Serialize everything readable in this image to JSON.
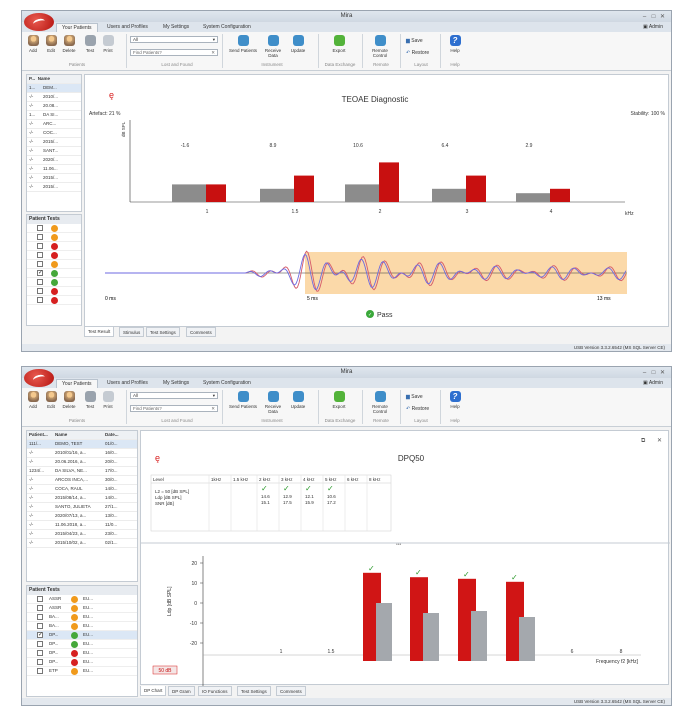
{
  "window_title": "Mira",
  "ribbon_tabs": [
    "Your Patients",
    "Users and Profiles",
    "My Settings",
    "System Configuration"
  ],
  "user_label": "Admin",
  "ribbon": {
    "buttons": [
      "Add",
      "Edit",
      "Delete",
      "Test",
      "Print"
    ],
    "filter_value": "All",
    "find_placeholder": "Find Patients?",
    "instrument_buttons": [
      "Send Patients",
      "Receive Data",
      "Update"
    ],
    "export_label": "Export",
    "remote_label": "Remote Control",
    "save_label": "Save",
    "restore_label": "Restore",
    "help_label": "Help",
    "groups": [
      "Patients",
      "Lost and Found",
      "Instrument",
      "Data Exchange",
      "Remote",
      "Layout",
      "Help"
    ]
  },
  "status_text": "USB   Version 3.3.2.6542 (MS SQL Server CE)",
  "window1": {
    "patient_cols": [
      "P...",
      "Name"
    ],
    "patients": [
      [
        "1...",
        "DEM..."
      ],
      [
        "-/-",
        "2010/..."
      ],
      [
        "-/-",
        "20.08..."
      ],
      [
        "1...",
        "DA SI..."
      ],
      [
        "-/-",
        "ARC..."
      ],
      [
        "-/-",
        "COC..."
      ],
      [
        "-/-",
        "2015/..."
      ],
      [
        "-/-",
        "SANT..."
      ],
      [
        "-/-",
        "2020/..."
      ],
      [
        "-/-",
        "11.06..."
      ],
      [
        "-/-",
        "2015/..."
      ],
      [
        "-/-",
        "2015/..."
      ]
    ],
    "tests_header": "Patient Tests",
    "test_dots": [
      "dorange",
      "dorange",
      "dred",
      "dred",
      "dorange",
      "dgreen",
      "dgreen",
      "dred",
      "dred"
    ],
    "checked_row": 5,
    "title": "TEOAE Diagnostic",
    "artefact": "Artefact: 21 %",
    "stability": "Stability: 100 %",
    "ylabel": "dB SPL",
    "band_values": [
      "-1.6",
      "8.9",
      "10.6",
      "6.4",
      "2.9"
    ],
    "x_labels": [
      "1",
      "1.5",
      "2",
      "3",
      "4"
    ],
    "x_unit": "kHz",
    "wave_start": "0 ms",
    "wave_mid": "5 ms",
    "wave_end": "13 ms",
    "result": "Pass",
    "tabs": [
      "Test Result",
      "Stimulus",
      "Test Settings",
      "Comments"
    ]
  },
  "window2": {
    "patient_cols": [
      "Patient...",
      "Name",
      "Date..."
    ],
    "patients": [
      [
        "111/...",
        "DEMO, TEST",
        "01/0..."
      ],
      [
        "-/-",
        "2010/01/16, a...",
        "16/0..."
      ],
      [
        "-/-",
        "20.06.2016, a...",
        "20/0..."
      ],
      [
        "1234/...",
        "DA SILVA, NE...",
        "17/0..."
      ],
      [
        "-/-",
        "ARCOS INCA,...",
        "30/0..."
      ],
      [
        "-/-",
        "COCA, RAUL",
        "14/0..."
      ],
      [
        "-/-",
        "2015/08/14, a...",
        "14/0..."
      ],
      [
        "-/-",
        "SANTO, JULIETA",
        "27/1..."
      ],
      [
        "-/-",
        "2020/07/13, a...",
        "13/0..."
      ],
      [
        "-/-",
        "11.06.2018, a...",
        "11/0..."
      ],
      [
        "-/-",
        "2015/04/23, a...",
        "23/0..."
      ],
      [
        "-/-",
        "2015/10/02, a...",
        "02/1..."
      ]
    ],
    "tests_header": "Patient Tests",
    "tests": [
      [
        "ASSR",
        "dorange",
        "EU..."
      ],
      [
        "ASSR",
        "dorange",
        "EU..."
      ],
      [
        "BA...",
        "dorange",
        "EU..."
      ],
      [
        "BA...",
        "dorange",
        "EU..."
      ],
      [
        "DP...",
        "dgreen",
        "EU..."
      ],
      [
        "DP...",
        "dgreen",
        "EU..."
      ],
      [
        "DP...",
        "dred",
        "EU..."
      ],
      [
        "DP...",
        "dred",
        "EU..."
      ],
      [
        "ETP",
        "dorange",
        "EU..."
      ]
    ],
    "checked_row": 4,
    "title": "DPQ50",
    "table_headers": [
      "Level",
      "1kHz",
      "1.5 kHz",
      "2 kHz",
      "3 kHz",
      "4 kHz",
      "5 kHz",
      "6 kHz",
      "8 kHz"
    ],
    "level_labels": [
      "L2 = 50 [dB SPL]",
      "Ldp [dB SPL]",
      "SNR [dB]"
    ],
    "table_values": [
      [
        "14.6",
        "15.1"
      ],
      [
        "12.9",
        "17.5"
      ],
      [
        "12.1",
        "15.9"
      ],
      [
        "10.6",
        "17.2"
      ]
    ],
    "ylabel": "Ldp [dB SPL]",
    "xlabel": "Frequency f2 [kHz]",
    "x_ticks": [
      "1",
      "1.5",
      "2",
      "3",
      "4",
      "5",
      "6",
      "8"
    ],
    "y_ticks": [
      "20",
      "10",
      "0",
      "-10",
      "-20"
    ],
    "legend_tag": "50 dB",
    "tabs": [
      "DP Chart",
      "DP Gram",
      "IO Functions",
      "Test Settings",
      "Comments"
    ]
  },
  "chart_data": [
    {
      "type": "bar",
      "title": "TEOAE Diagnostic",
      "categories": [
        "1",
        "1.5",
        "2",
        "3",
        "4"
      ],
      "series": [
        {
          "values": [
            4,
            3,
            4,
            3,
            2
          ],
          "color": "#8c8c8c"
        },
        {
          "values": [
            4,
            6,
            9,
            6,
            3
          ],
          "color": "#c81010"
        }
      ],
      "ylabel": "dB SPL",
      "xlabel": "kHz"
    },
    {
      "type": "bar",
      "title": "DPQ50",
      "categories": [
        "1",
        "1.5",
        "2",
        "3",
        "4",
        "5",
        "6",
        "8"
      ],
      "series": [
        {
          "values": [
            null,
            null,
            15.1,
            12.9,
            12.1,
            10.6,
            null,
            null
          ],
          "color": "#d01515"
        },
        {
          "values": [
            null,
            null,
            0,
            -5,
            -4,
            -7,
            null,
            null
          ],
          "color": "#a4a8ad"
        }
      ],
      "ylabel": "Ldp [dB SPL]",
      "xlabel": "Frequency f2 [kHz]",
      "ylim": [
        -25,
        25
      ]
    }
  ]
}
